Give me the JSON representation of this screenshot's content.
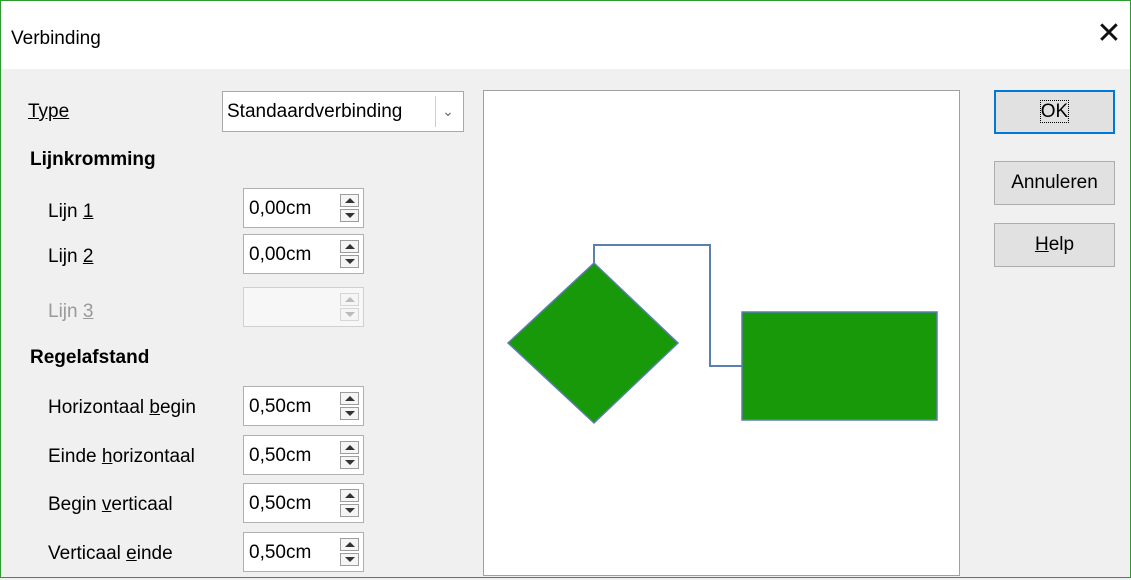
{
  "window": {
    "title": "Verbinding"
  },
  "type": {
    "label": "Type",
    "value": "Standaardverbinding"
  },
  "lijnkromming": {
    "heading": "Lijnkromming",
    "lines": [
      {
        "label_pre": "Lijn ",
        "label_acc": "1",
        "value": "0,00cm",
        "enabled": true
      },
      {
        "label_pre": "Lijn ",
        "label_acc": "2",
        "value": "0,00cm",
        "enabled": true
      },
      {
        "label_pre": "Lijn ",
        "label_acc": "3",
        "value": "",
        "enabled": false
      }
    ]
  },
  "regelafstand": {
    "heading": "Regelafstand",
    "items": [
      {
        "label_pre": "Horizontaal ",
        "label_acc": "b",
        "label_post": "egin",
        "value": "0,50cm"
      },
      {
        "label_pre": "Einde ",
        "label_acc": "h",
        "label_post": "orizontaal",
        "value": "0,50cm"
      },
      {
        "label_pre": "Begin ",
        "label_acc": "v",
        "label_post": "erticaal",
        "value": "0,50cm"
      },
      {
        "label_pre": "Verticaal ",
        "label_acc": "e",
        "label_post": "inde",
        "value": "0,50cm"
      }
    ]
  },
  "buttons": {
    "ok": "OK",
    "cancel": "Annuleren",
    "help_acc": "H",
    "help_rest": "elp"
  },
  "preview": {
    "shape_fill": "#18990a",
    "shape_stroke": "#5b7fae",
    "connector_color": "#5b7fae"
  }
}
